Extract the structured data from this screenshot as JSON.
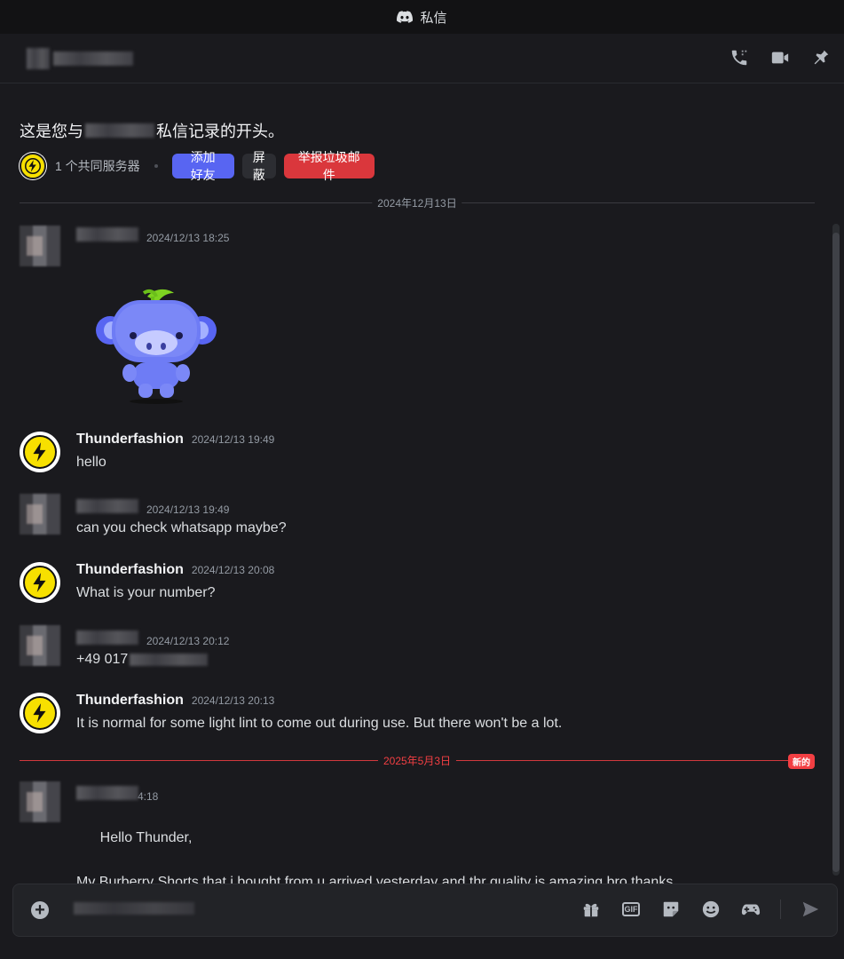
{
  "window": {
    "title": "私信"
  },
  "intro": {
    "text_before": "这是您与",
    "text_after": "私信记录的开头。",
    "mutual_servers": "1 个共同服务器",
    "add_friend": "添加好友",
    "block": "屏蔽",
    "report_spam": "举报垃圾邮件"
  },
  "dividers": {
    "first": "2024年12月13日",
    "second": "2025年5月3日",
    "new_badge": "新的"
  },
  "messages": [
    {
      "author": "",
      "timestamp": "2024/12/13 18:25",
      "body": ""
    },
    {
      "author": "Thunderfashion",
      "timestamp": "2024/12/13 19:49",
      "body": "hello"
    },
    {
      "author": "",
      "timestamp": "2024/12/13 19:49",
      "body": "can you check whatsapp maybe?"
    },
    {
      "author": "Thunderfashion",
      "timestamp": "2024/12/13 20:08",
      "body": "What is your number?"
    },
    {
      "author": "",
      "timestamp": "2024/12/13 20:12",
      "body": "+49 017"
    },
    {
      "author": "Thunderfashion",
      "timestamp": "2024/12/13 20:13",
      "body": "It is normal for some light lint to come out during use. But there won't be a lot."
    },
    {
      "author": "",
      "timestamp": "4:18",
      "body": "Hello Thunder,\n\nMy Burberry Shorts that i bought from u arrived yesterday and thr quality is amazing bro thanks"
    }
  ],
  "colors": {
    "accent": "#5865f2",
    "danger": "#da373c",
    "thunder_yellow": "#f7e000",
    "new_line": "#f23f43",
    "heart": "#e5222b"
  },
  "icons": {
    "header": [
      "phone-icon",
      "video-icon",
      "pin-icon"
    ],
    "composer": [
      "gift-icon",
      "gif-icon",
      "sticker-icon",
      "emoji-icon",
      "game-icon",
      "send-icon"
    ]
  }
}
